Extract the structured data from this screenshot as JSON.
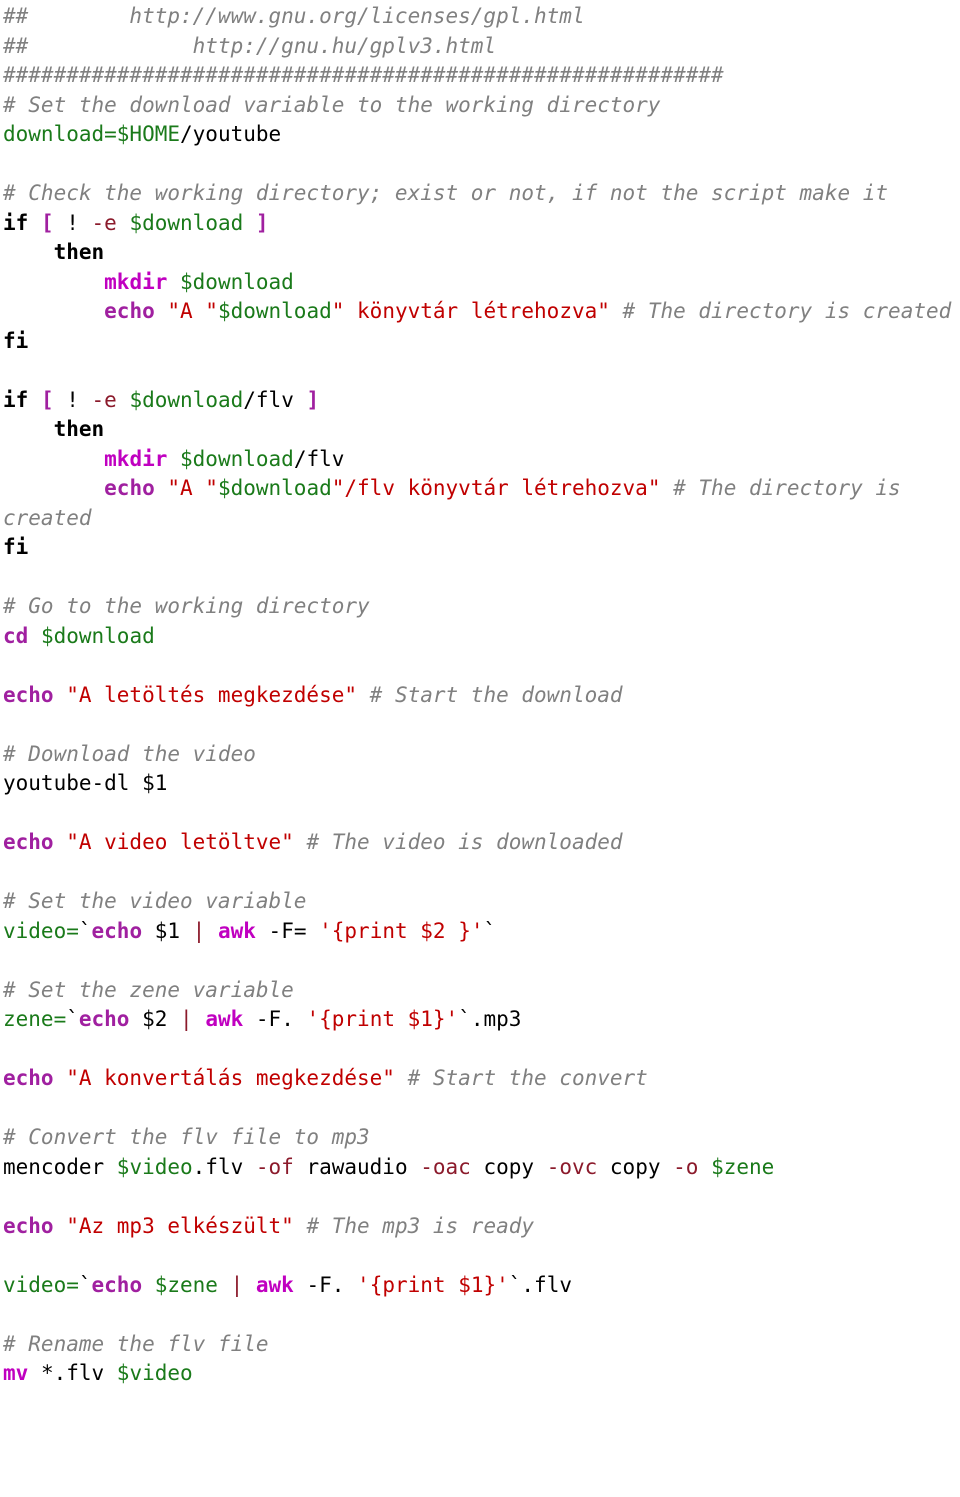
{
  "document": {
    "kind": "shell-script-listing",
    "language": "bash",
    "title": "youtube-dl download and convert script"
  },
  "colors": {
    "background": "#ffffff",
    "comment": "#808080",
    "keyword": "#000000",
    "command": "#a020a0",
    "command_alt": "#c000c0",
    "variable": "#1a7a1a",
    "string": "#c00000",
    "option": "#8b1a2b",
    "bracket": "#a020a0",
    "plain": "#000000"
  },
  "lines": [
    {
      "id": "l01",
      "tokens": [
        {
          "t": "cmt",
          "s": "##        http://www.gnu.org/licenses/gpl.html"
        }
      ]
    },
    {
      "id": "l02",
      "tokens": [
        {
          "t": "cmt",
          "s": "##             http://gnu.hu/gplv3.html"
        }
      ]
    },
    {
      "id": "l03",
      "tokens": [
        {
          "t": "cmt",
          "s": "#########################################################"
        }
      ]
    },
    {
      "id": "l04",
      "tokens": [
        {
          "t": "cmt",
          "s": "# Set the download variable to the working directory"
        }
      ]
    },
    {
      "id": "l05",
      "tokens": [
        {
          "t": "var",
          "s": "download=$HOME"
        },
        {
          "t": "plain",
          "s": "/youtube"
        }
      ]
    },
    {
      "id": "l06",
      "tokens": [
        {
          "t": "plain",
          "s": ""
        }
      ]
    },
    {
      "id": "l07",
      "tokens": [
        {
          "t": "cmt",
          "s": "# Check the working directory; exist or not, if not the script make it"
        }
      ]
    },
    {
      "id": "l08",
      "tokens": [
        {
          "t": "kw",
          "s": "if "
        },
        {
          "t": "brk",
          "s": "[ "
        },
        {
          "t": "plain",
          "s": "! "
        },
        {
          "t": "opt",
          "s": "-e "
        },
        {
          "t": "var",
          "s": "$download "
        },
        {
          "t": "brk",
          "s": "]"
        }
      ]
    },
    {
      "id": "l09",
      "tokens": [
        {
          "t": "plain",
          "s": "    "
        },
        {
          "t": "kw",
          "s": "then"
        }
      ]
    },
    {
      "id": "l10",
      "tokens": [
        {
          "t": "plain",
          "s": "        "
        },
        {
          "t": "cmd2",
          "s": "mkdir "
        },
        {
          "t": "var",
          "s": "$download"
        }
      ]
    },
    {
      "id": "l11",
      "tokens": [
        {
          "t": "plain",
          "s": "        "
        },
        {
          "t": "cmd",
          "s": "echo "
        },
        {
          "t": "str",
          "s": "\"A \""
        },
        {
          "t": "var",
          "s": "$download"
        },
        {
          "t": "str",
          "s": "\" könyvtár létrehozva\" "
        },
        {
          "t": "cmt",
          "s": "# The directory is created"
        }
      ]
    },
    {
      "id": "l12",
      "tokens": [
        {
          "t": "kw",
          "s": "fi"
        }
      ]
    },
    {
      "id": "l13",
      "tokens": [
        {
          "t": "plain",
          "s": ""
        }
      ]
    },
    {
      "id": "l14",
      "tokens": [
        {
          "t": "kw",
          "s": "if "
        },
        {
          "t": "brk",
          "s": "[ "
        },
        {
          "t": "plain",
          "s": "! "
        },
        {
          "t": "opt",
          "s": "-e "
        },
        {
          "t": "var",
          "s": "$download"
        },
        {
          "t": "plain",
          "s": "/flv "
        },
        {
          "t": "brk",
          "s": "]"
        }
      ]
    },
    {
      "id": "l15",
      "tokens": [
        {
          "t": "plain",
          "s": "    "
        },
        {
          "t": "kw",
          "s": "then"
        }
      ]
    },
    {
      "id": "l16",
      "tokens": [
        {
          "t": "plain",
          "s": "        "
        },
        {
          "t": "cmd2",
          "s": "mkdir "
        },
        {
          "t": "var",
          "s": "$download"
        },
        {
          "t": "plain",
          "s": "/flv"
        }
      ]
    },
    {
      "id": "l17",
      "tokens": [
        {
          "t": "plain",
          "s": "        "
        },
        {
          "t": "cmd",
          "s": "echo "
        },
        {
          "t": "str",
          "s": "\"A \""
        },
        {
          "t": "var",
          "s": "$download"
        },
        {
          "t": "str",
          "s": "\"/flv könyvtár létrehozva\" "
        },
        {
          "t": "cmt",
          "s": "# The directory is created"
        }
      ]
    },
    {
      "id": "l18",
      "tokens": [
        {
          "t": "kw",
          "s": "fi"
        }
      ]
    },
    {
      "id": "l19",
      "tokens": [
        {
          "t": "plain",
          "s": ""
        }
      ]
    },
    {
      "id": "l20",
      "tokens": [
        {
          "t": "cmt",
          "s": "# Go to the working directory"
        }
      ]
    },
    {
      "id": "l21",
      "tokens": [
        {
          "t": "cmd",
          "s": "cd "
        },
        {
          "t": "var",
          "s": "$download"
        }
      ]
    },
    {
      "id": "l22",
      "tokens": [
        {
          "t": "plain",
          "s": ""
        }
      ]
    },
    {
      "id": "l23",
      "tokens": [
        {
          "t": "cmd",
          "s": "echo "
        },
        {
          "t": "str",
          "s": "\"A letöltés megkezdése\" "
        },
        {
          "t": "cmt",
          "s": "# Start the download"
        }
      ]
    },
    {
      "id": "l24",
      "tokens": [
        {
          "t": "plain",
          "s": ""
        }
      ]
    },
    {
      "id": "l25",
      "tokens": [
        {
          "t": "cmt",
          "s": "# Download the video"
        }
      ]
    },
    {
      "id": "l26",
      "tokens": [
        {
          "t": "plain",
          "s": "youtube-dl $1"
        }
      ]
    },
    {
      "id": "l27",
      "tokens": [
        {
          "t": "plain",
          "s": ""
        }
      ]
    },
    {
      "id": "l28",
      "tokens": [
        {
          "t": "cmd",
          "s": "echo "
        },
        {
          "t": "str",
          "s": "\"A video letöltve\" "
        },
        {
          "t": "cmt",
          "s": "# The video is downloaded"
        }
      ]
    },
    {
      "id": "l29",
      "tokens": [
        {
          "t": "plain",
          "s": ""
        }
      ]
    },
    {
      "id": "l30",
      "tokens": [
        {
          "t": "cmt",
          "s": "# Set the video variable"
        }
      ]
    },
    {
      "id": "l31",
      "tokens": [
        {
          "t": "var",
          "s": "video="
        },
        {
          "t": "plain",
          "s": "`"
        },
        {
          "t": "cmd",
          "s": "echo "
        },
        {
          "t": "plain",
          "s": "$1 "
        },
        {
          "t": "pipe",
          "s": "| "
        },
        {
          "t": "cmd2",
          "s": "awk "
        },
        {
          "t": "plain",
          "s": "-F= "
        },
        {
          "t": "str",
          "s": "'{print $2 }'"
        },
        {
          "t": "plain",
          "s": "`"
        }
      ]
    },
    {
      "id": "l32",
      "tokens": [
        {
          "t": "plain",
          "s": ""
        }
      ]
    },
    {
      "id": "l33",
      "tokens": [
        {
          "t": "cmt",
          "s": "# Set the zene variable"
        }
      ]
    },
    {
      "id": "l34",
      "tokens": [
        {
          "t": "var",
          "s": "zene="
        },
        {
          "t": "plain",
          "s": "`"
        },
        {
          "t": "cmd",
          "s": "echo "
        },
        {
          "t": "plain",
          "s": "$2 "
        },
        {
          "t": "pipe",
          "s": "| "
        },
        {
          "t": "cmd2",
          "s": "awk "
        },
        {
          "t": "plain",
          "s": "-F. "
        },
        {
          "t": "str",
          "s": "'{print $1}'"
        },
        {
          "t": "plain",
          "s": "`.mp3"
        }
      ]
    },
    {
      "id": "l35",
      "tokens": [
        {
          "t": "plain",
          "s": ""
        }
      ]
    },
    {
      "id": "l36",
      "tokens": [
        {
          "t": "cmd",
          "s": "echo "
        },
        {
          "t": "str",
          "s": "\"A konvertálás megkezdése\" "
        },
        {
          "t": "cmt",
          "s": "# Start the convert"
        }
      ]
    },
    {
      "id": "l37",
      "tokens": [
        {
          "t": "plain",
          "s": ""
        }
      ]
    },
    {
      "id": "l38",
      "tokens": [
        {
          "t": "cmt",
          "s": "# Convert the flv file to mp3"
        }
      ]
    },
    {
      "id": "l39",
      "tokens": [
        {
          "t": "plain",
          "s": "mencoder "
        },
        {
          "t": "var",
          "s": "$video"
        },
        {
          "t": "plain",
          "s": ".flv "
        },
        {
          "t": "opt",
          "s": "-of "
        },
        {
          "t": "plain",
          "s": "rawaudio "
        },
        {
          "t": "opt",
          "s": "-oac "
        },
        {
          "t": "plain",
          "s": "copy "
        },
        {
          "t": "opt",
          "s": "-ovc "
        },
        {
          "t": "plain",
          "s": "copy "
        },
        {
          "t": "opt",
          "s": "-o "
        },
        {
          "t": "var",
          "s": "$zene"
        }
      ]
    },
    {
      "id": "l40",
      "tokens": [
        {
          "t": "plain",
          "s": ""
        }
      ]
    },
    {
      "id": "l41",
      "tokens": [
        {
          "t": "cmd",
          "s": "echo "
        },
        {
          "t": "str",
          "s": "\"Az mp3 elkészült\" "
        },
        {
          "t": "cmt",
          "s": "# The mp3 is ready"
        }
      ]
    },
    {
      "id": "l42",
      "tokens": [
        {
          "t": "plain",
          "s": ""
        }
      ]
    },
    {
      "id": "l43",
      "tokens": [
        {
          "t": "var",
          "s": "video="
        },
        {
          "t": "plain",
          "s": "`"
        },
        {
          "t": "cmd",
          "s": "echo "
        },
        {
          "t": "var",
          "s": "$zene "
        },
        {
          "t": "pipe",
          "s": "| "
        },
        {
          "t": "cmd2",
          "s": "awk "
        },
        {
          "t": "plain",
          "s": "-F. "
        },
        {
          "t": "str",
          "s": "'{print $1}'"
        },
        {
          "t": "plain",
          "s": "`.flv"
        }
      ]
    },
    {
      "id": "l44",
      "tokens": [
        {
          "t": "plain",
          "s": ""
        }
      ]
    },
    {
      "id": "l45",
      "tokens": [
        {
          "t": "cmt",
          "s": "# Rename the flv file"
        }
      ]
    },
    {
      "id": "l46",
      "tokens": [
        {
          "t": "cmd2",
          "s": "mv "
        },
        {
          "t": "plain",
          "s": "*.flv "
        },
        {
          "t": "var",
          "s": "$video"
        }
      ]
    }
  ]
}
